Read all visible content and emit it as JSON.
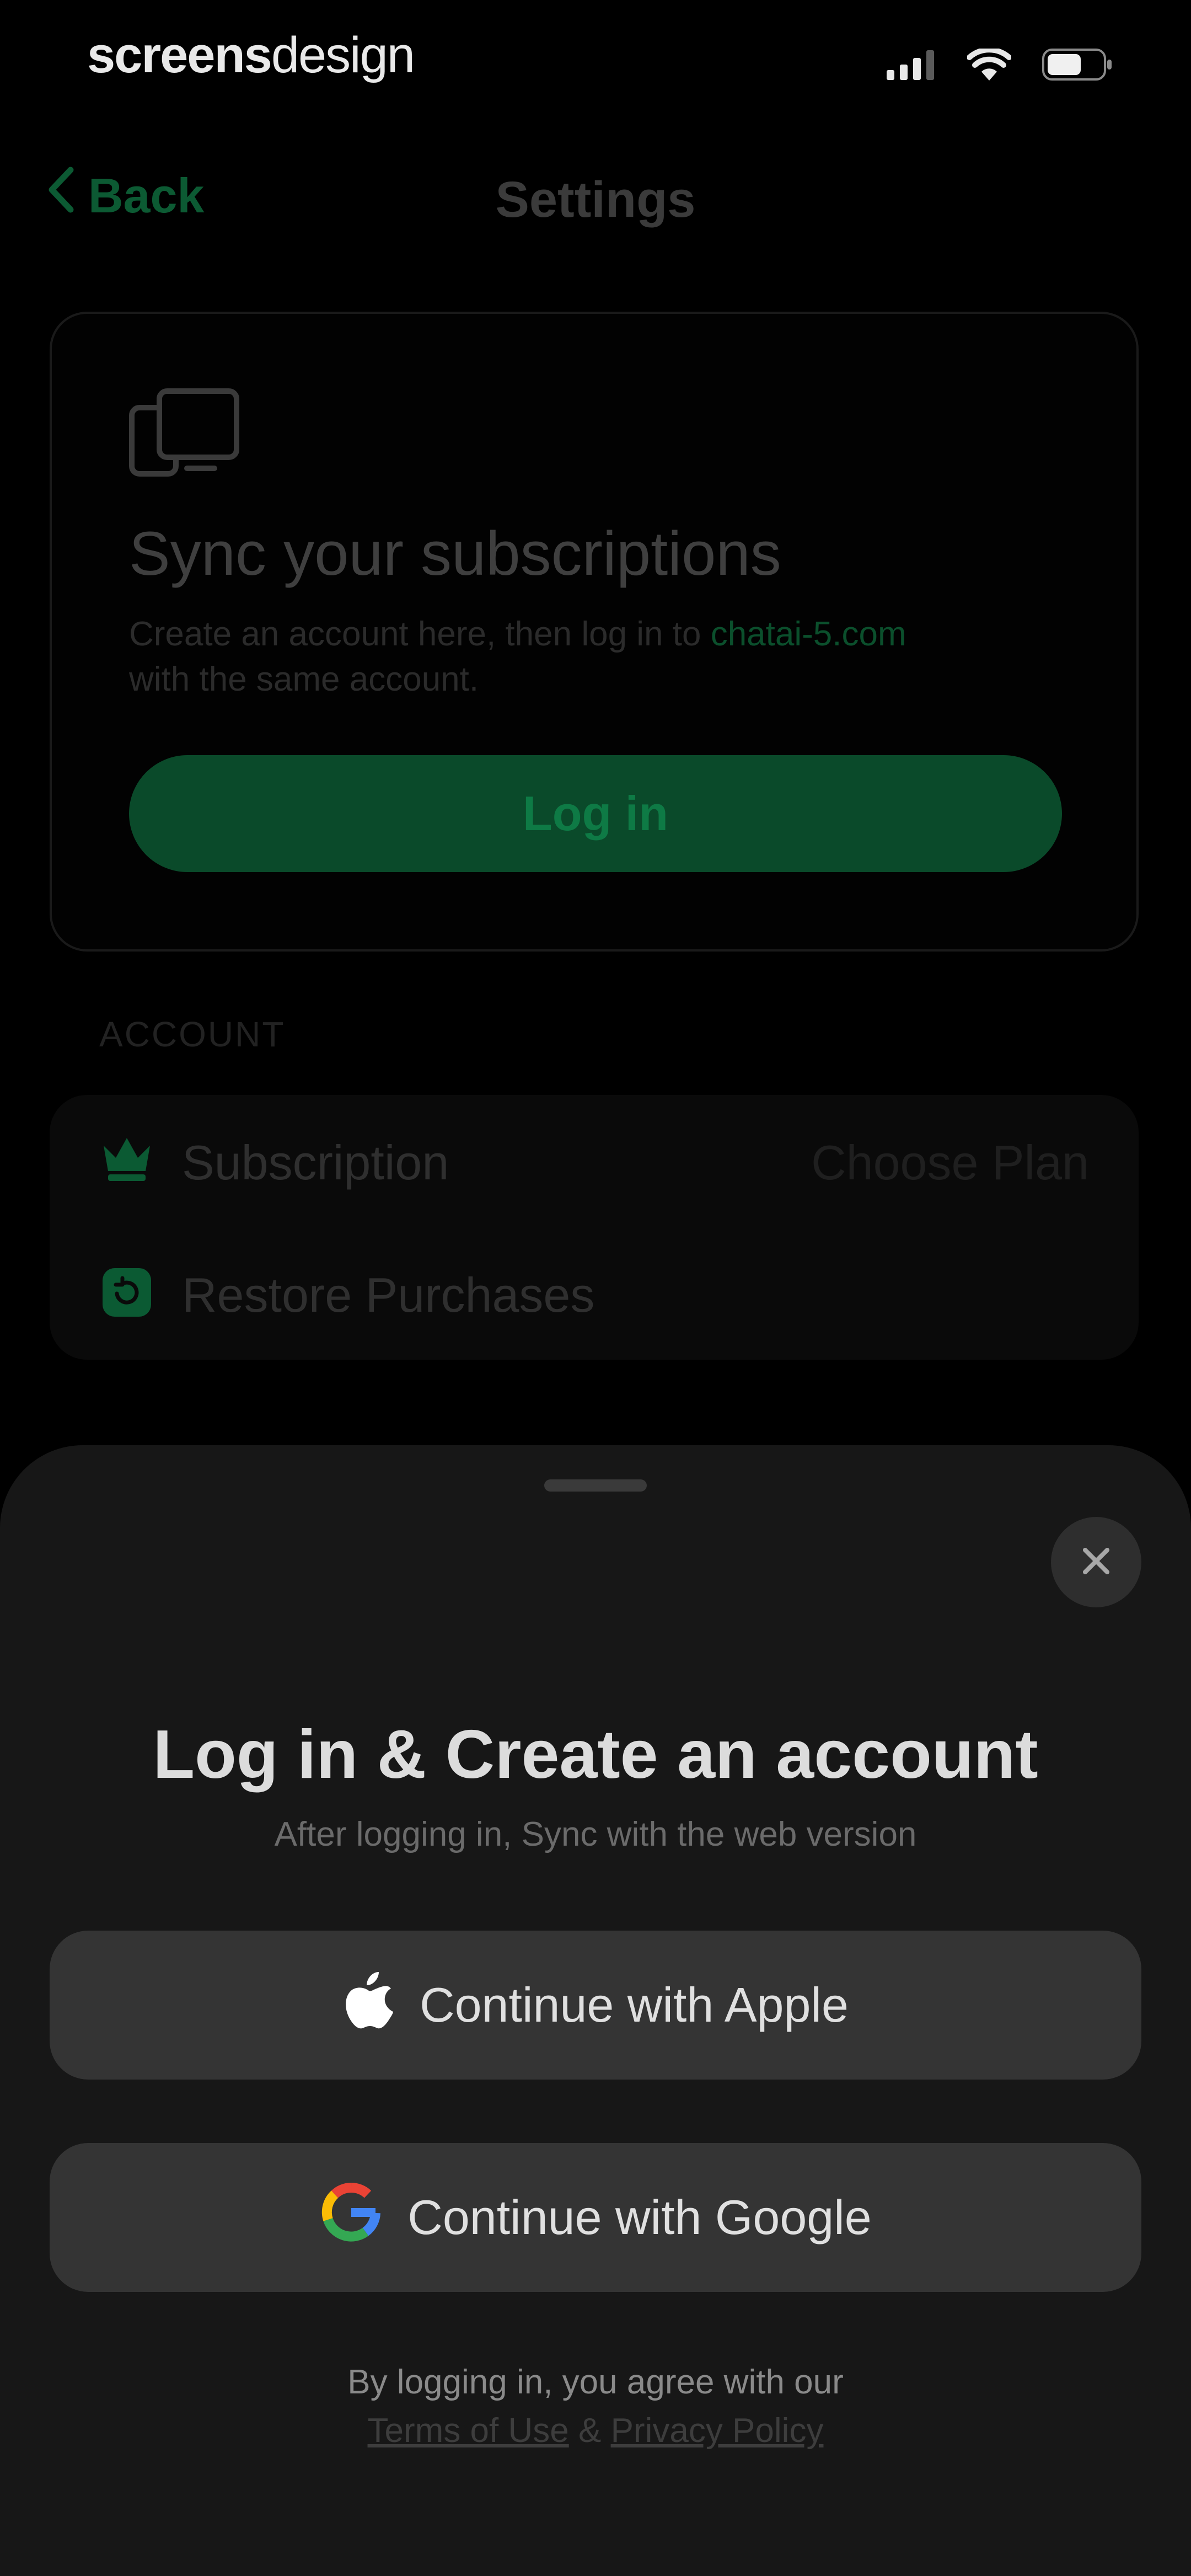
{
  "status_bar": {
    "brand_bold": "screens",
    "brand_light": "design",
    "icons": [
      "cellular-signal-icon",
      "wifi-icon",
      "battery-icon"
    ]
  },
  "nav": {
    "back_label": "Back",
    "title": "Settings"
  },
  "sync_card": {
    "icon": "devices-icon",
    "title": "Sync your subscriptions",
    "description_before_link": "Create an account here, then log in to ",
    "description_link": "chatai-5.com",
    "description_after_link": "with the same account.",
    "login_label": "Log in"
  },
  "account": {
    "header": "ACCOUNT",
    "rows": [
      {
        "icon": "crown-icon",
        "label": "Subscription",
        "value": "Choose Plan"
      },
      {
        "icon": "restore-icon",
        "label": "Restore Purchases",
        "value": ""
      }
    ]
  },
  "sheet": {
    "title": "Log in & Create an account",
    "subtitle": "After logging in, Sync with the web version",
    "apple_label": "Continue with Apple",
    "google_label": "Continue with Google",
    "legal_text": "By logging in, you agree with our",
    "terms_label": "Terms of Use",
    "legal_separator": "&",
    "privacy_label": "Privacy Policy"
  },
  "colors": {
    "accent_green": "#0a4a2a",
    "background": "#000000",
    "sheet_background": "#171717",
    "button_background": "#343434"
  }
}
